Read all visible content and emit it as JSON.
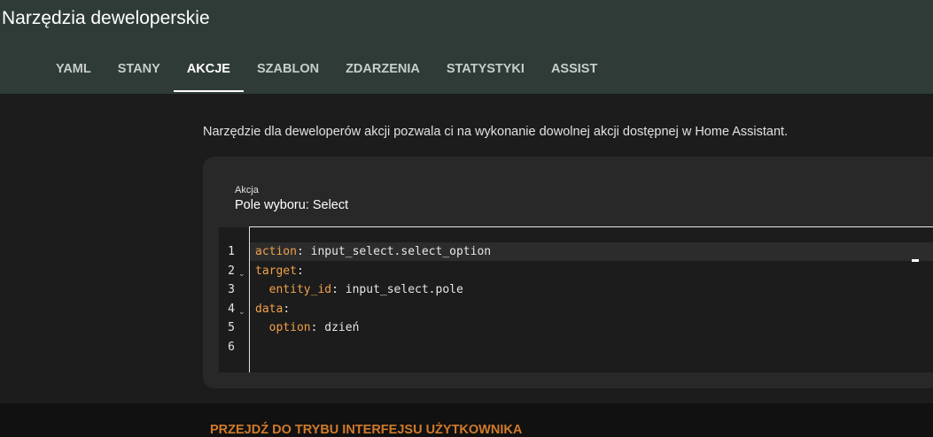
{
  "header": {
    "title": "Narzędzia deweloperskie",
    "tabs": [
      {
        "label": "YAML"
      },
      {
        "label": "STANY"
      },
      {
        "label": "AKCJE"
      },
      {
        "label": "SZABLON"
      },
      {
        "label": "ZDARZENIA"
      },
      {
        "label": "STATYSTYKI"
      },
      {
        "label": "ASSIST"
      }
    ],
    "active_tab": "AKCJE"
  },
  "main": {
    "description": "Narzędzie dla deweloperów akcji pozwala ci na wykonanie dowolnej akcji dostępnej w Home Assistant.",
    "action_field": {
      "label": "Akcja",
      "value": "Pole wyboru: Select"
    },
    "editor": {
      "lines": [
        {
          "number": "1",
          "key": "action",
          "value": " input_select.select_option",
          "indent": "",
          "foldable": false
        },
        {
          "number": "2",
          "key": "target",
          "value": "",
          "indent": "",
          "foldable": true
        },
        {
          "number": "3",
          "key": "entity_id",
          "value": " input_select.pole",
          "indent": "  ",
          "foldable": false
        },
        {
          "number": "4",
          "key": "data",
          "value": "",
          "indent": "",
          "foldable": true
        },
        {
          "number": "5",
          "key": "option",
          "value": " dzień",
          "indent": "  ",
          "foldable": false
        },
        {
          "number": "6",
          "key": "",
          "value": "",
          "indent": "",
          "foldable": false
        }
      ]
    }
  },
  "footer": {
    "link_label": "PRZEJDŹ DO TRYBU INTERFEJSU UŻYTKOWNIKA"
  },
  "colors": {
    "header_bg": "#2f3b37",
    "content_bg": "#1c1c1c",
    "card_bg": "#282828",
    "yaml_key": "#f0a04b",
    "footer_link": "#d07a2b"
  },
  "icons": {
    "fold": "chevron-down-icon"
  }
}
